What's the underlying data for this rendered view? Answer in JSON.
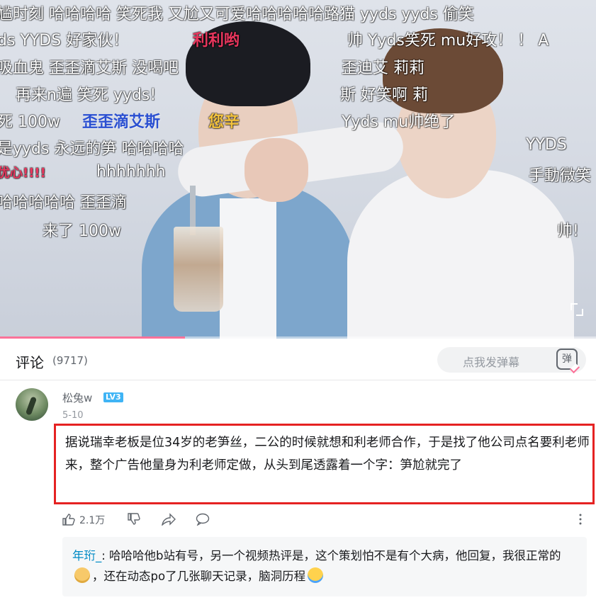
{
  "video": {
    "danmaku": [
      {
        "text": "尴时刻 哈哈哈哈   笑死我 又尬又可爱哈哈哈哈哈路猫   yyds   yyds  偷笑",
        "style": "white"
      },
      {
        "text": "ds YYDS  好家伙！",
        "style": "white"
      },
      {
        "text": "利利哟",
        "style": "red"
      },
      {
        "text": "帅 Yyds笑死     mu好攻！ ！ A",
        "style": "white"
      },
      {
        "text": "吸血鬼   歪歪滴艾斯  没喝吧",
        "style": "white"
      },
      {
        "text": "歪迪艾         莉莉",
        "style": "white"
      },
      {
        "text": "再来n遍    笑死 yyds!",
        "style": "white"
      },
      {
        "text": "斯              好笑啊  莉",
        "style": "white"
      },
      {
        "text": "死 100w",
        "style": "white"
      },
      {
        "text": "歪歪滴艾斯",
        "style": "blue"
      },
      {
        "text": "您辛",
        "style": "yellow"
      },
      {
        "text": "Yyds          mu帅绝了",
        "style": "white"
      },
      {
        "text": "是yyds 永远的笋    哈哈哈哈",
        "style": "white"
      },
      {
        "text": "YYDS",
        "style": "white"
      },
      {
        "text": "优心!!!!",
        "style": "red"
      },
      {
        "text": "hhhhhhh",
        "style": "white"
      },
      {
        "text": "手動微笑",
        "style": "white"
      },
      {
        "text": "哈哈哈哈哈   歪歪滴",
        "style": "white"
      },
      {
        "text": "来了   100w",
        "style": "white"
      },
      {
        "text": "帅!",
        "style": "white"
      }
    ],
    "progress": 0.31,
    "accent_color": "#fb7299"
  },
  "comments_header": {
    "title": "评论",
    "count": "(9717)",
    "danmu_placeholder": "点我发弹幕",
    "danmu_button": "弹"
  },
  "comment": {
    "username": "松兔w",
    "level": "LV3",
    "date": "5-10",
    "text": "据说瑞幸老板是位34岁的老笋丝，二公的时候就想和利老师合作，于是找了他公司点名要利老师来，整个广告他量身为利老师定做，从头到尾透露着一个字：笋尬就完了",
    "likes": "2.1万",
    "highlight_color": "#e52222"
  },
  "reply": {
    "username": "年珩_",
    "text_before_emoji": ": 哈哈哈他b站有号，另一个视频热评是，这个策划怕不是有个大病，他回复，我很正常的",
    "text_after_emoji": "，还在动态po了几张聊天记录，脑洞历程",
    "emoji_1": "cat-face-emoji",
    "emoji_2": "crying-face-emoji"
  },
  "icons": [
    "like-icon",
    "dislike-icon",
    "share-icon",
    "reply-icon",
    "more-icon",
    "fullscreen-icon",
    "danmu-icon"
  ]
}
